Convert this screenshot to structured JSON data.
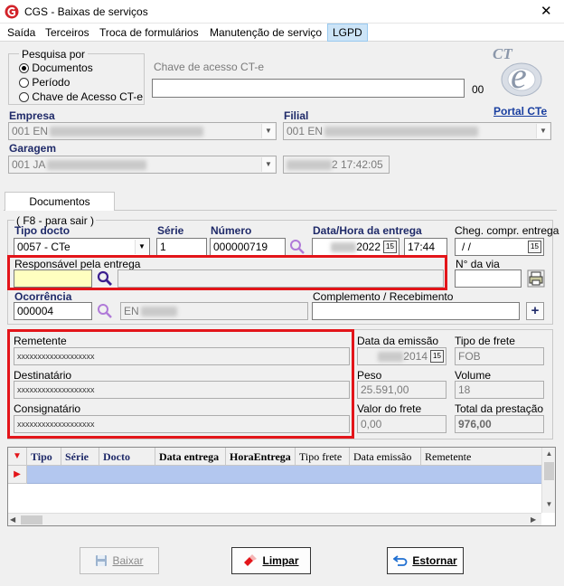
{
  "window": {
    "title": "CGS - Baixas de serviços",
    "close_glyph": "✕"
  },
  "menu": [
    "Saída",
    "Terceiros",
    "Troca de formulários",
    "Manutenção de serviço",
    "LGPD"
  ],
  "search": {
    "group_label": "Pesquisa por",
    "options": [
      "Documentos",
      "Período",
      "Chave de Acesso CT-e"
    ],
    "selected": "Documentos",
    "key_label": "Chave de acesso CT-e",
    "key_value": "",
    "key_suffix": "00"
  },
  "cte": {
    "logo_text": "CT",
    "logo_e": "e",
    "portal_link": "Portal CTe"
  },
  "empresa": {
    "label": "Empresa",
    "value": "001 EN"
  },
  "filial": {
    "label": "Filial",
    "value": "001 EN"
  },
  "garagem": {
    "label": "Garagem",
    "value": "001 JA",
    "datetime_tail": "2 17:42:05"
  },
  "tab": {
    "label": "Documentos"
  },
  "frame_hint": "( F8 - para sair )",
  "doc": {
    "tipo_label": "Tipo docto",
    "tipo_value": "0057 - CTe",
    "serie_label": "Série",
    "serie_value": "1",
    "numero_label": "Número",
    "numero_value": "000000719",
    "data_label": "Data/Hora da entrega",
    "data_tail": "2022",
    "hora_value": "17:44",
    "cheg_label": "Cheg. compr. entrega",
    "cheg_value": " /  /"
  },
  "responsavel": {
    "label": "Responsável pela entrega",
    "value": ""
  },
  "via": {
    "label": "N° da via",
    "value": ""
  },
  "ocorrencia": {
    "label": "Ocorrência",
    "code": "000004",
    "desc": "EN"
  },
  "complemento": {
    "label": "Complemento / Recebimento",
    "value": "",
    "add_glyph": "+"
  },
  "parties": {
    "remetente_label": "Remetente",
    "remetente_value": "xxxxxxxxxxxxxxxxxxx",
    "destinatario_label": "Destinatário",
    "destinatario_value": "xxxxxxxxxxxxxxxxxxx",
    "consignatario_label": "Consignatário",
    "consignatario_value": "xxxxxxxxxxxxxxxxxxx"
  },
  "summary": {
    "emissao_label": "Data da emissão",
    "emissao_tail": "2014",
    "frete_tipo_label": "Tipo de frete",
    "frete_tipo_value": "FOB",
    "peso_label": "Peso",
    "peso_value": "25.591,00",
    "volume_label": "Volume",
    "volume_value": "18",
    "valor_label": "Valor do frete",
    "valor_value": "0,00",
    "total_label": "Total da prestação",
    "total_value": "976,00"
  },
  "grid": {
    "columns": [
      "Tipo",
      "Série",
      "Docto",
      "Data entrega",
      "HoraEntrega",
      "Tipo frete",
      "Data emissão",
      "Remetente"
    ]
  },
  "buttons": {
    "baixar": "Baixar",
    "limpar": "Limpar",
    "estornar": "Estornar"
  },
  "colors": {
    "accent_red": "#e3151a",
    "label_blue": "#1f2a69",
    "selection_blue": "#b3c7ef",
    "focus_yellow": "#ffffc0"
  }
}
